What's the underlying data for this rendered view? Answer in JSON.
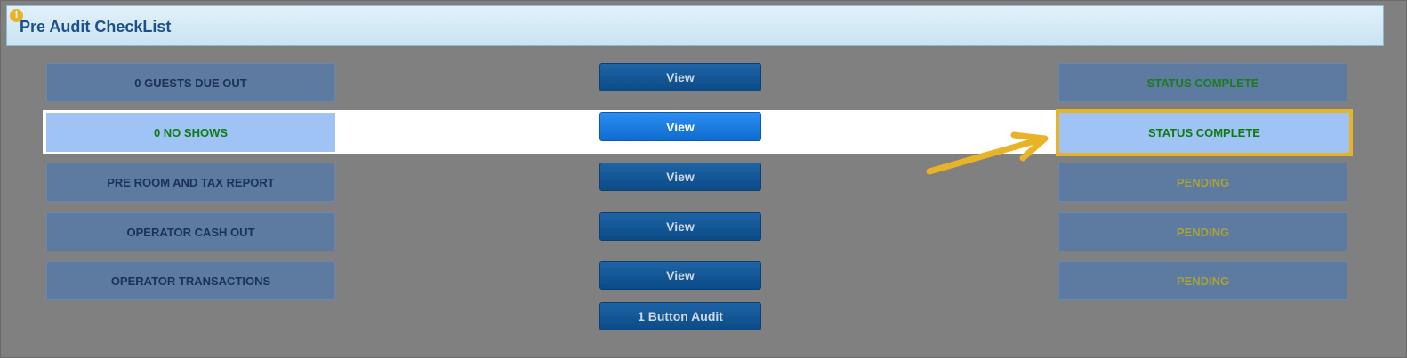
{
  "header": {
    "title": "Pre Audit CheckList",
    "info_glyph": "i"
  },
  "rows": [
    {
      "label": "0 GUESTS DUE OUT",
      "action": "View",
      "status": "STATUS COMPLETE"
    },
    {
      "label": "0 NO SHOWS",
      "action": "View",
      "status": "STATUS COMPLETE"
    },
    {
      "label": "PRE ROOM AND TAX REPORT",
      "action": "View",
      "status": "PENDING"
    },
    {
      "label": "OPERATOR CASH OUT",
      "action": "View",
      "status": "PENDING"
    },
    {
      "label": "OPERATOR TRANSACTIONS",
      "action": "View",
      "status": "PENDING"
    }
  ],
  "audit_button": "1 Button Audit",
  "colors": {
    "accent_highlight": "#e9b328",
    "status_complete": "#0f7a0f",
    "status_pending": "#a8a13a",
    "header_title": "#1d4f8a"
  },
  "icons": {
    "info": "info-icon",
    "pointer": "arrow-pointer"
  }
}
